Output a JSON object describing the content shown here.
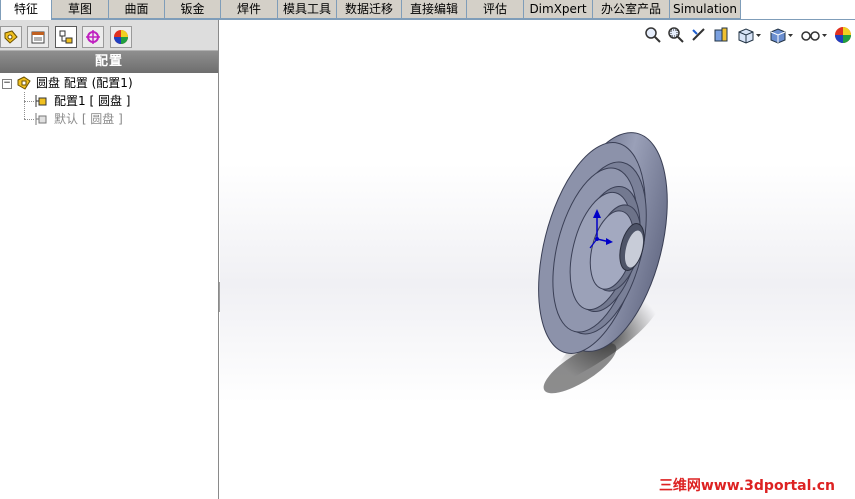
{
  "tabs": [
    {
      "label": "特征",
      "active": true
    },
    {
      "label": "草图",
      "active": false
    },
    {
      "label": "曲面",
      "active": false
    },
    {
      "label": "钣金",
      "active": false
    },
    {
      "label": "焊件",
      "active": false
    },
    {
      "label": "模具工具",
      "active": false
    },
    {
      "label": "数据迁移",
      "active": false
    },
    {
      "label": "直接编辑",
      "active": false
    },
    {
      "label": "评估",
      "active": false
    },
    {
      "label": "DimXpert",
      "active": false
    },
    {
      "label": "办公室产品",
      "active": false
    },
    {
      "label": "Simulation",
      "active": false
    }
  ],
  "panel": {
    "tab_icons": [
      "feature-manager-icon",
      "property-manager-icon",
      "configuration-manager-icon",
      "dimxpert-manager-icon",
      "display-manager-icon"
    ],
    "header": "配置",
    "tree": {
      "root": {
        "label": "圆盘 配置  (配置1)",
        "expander": "−"
      },
      "children": [
        {
          "label": "配置1 [ 圆盘 ]",
          "active": true
        },
        {
          "label": "默认 [ 圆盘 ]",
          "active": false
        }
      ]
    }
  },
  "splitter": {
    "glyph": "◂◂◂"
  },
  "view_toolbar": [
    "zoom-to-fit-icon",
    "zoom-to-area-icon",
    "previous-view-icon",
    "section-view-icon",
    "view-orientation-icon",
    "display-style-icon",
    "hide-show-items-icon",
    "appearance-icon"
  ],
  "watermark": "三维网www.3dportal.cn",
  "colors": {
    "tab_bg": "#d4d0c8",
    "panel_header": "#7a7a7a",
    "part": "#8a90a8",
    "triad_x": "#0000c8"
  }
}
